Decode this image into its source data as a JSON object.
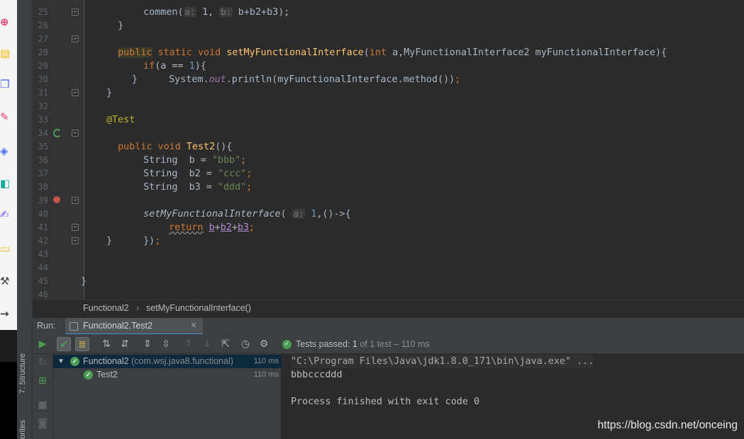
{
  "editor": {
    "line_numbers": [
      "25",
      "26",
      "27",
      "28",
      "29",
      "30",
      "31",
      "32",
      "33",
      "34",
      "35",
      "36",
      "37",
      "38",
      "39",
      "40",
      "41",
      "42",
      "43",
      "44",
      "45",
      "46"
    ],
    "code": {
      "l25_a": "commen(",
      "l25_h1": "a:",
      "l25_b": " 1, ",
      "l25_h2": "b:",
      "l25_c": " b+b2+b3);",
      "l25_close": "}",
      "l27_public": "public",
      "l27_static": " static void ",
      "l27_fn": "setMyFunctionalInterface",
      "l27_open": "(",
      "l27_int": "int",
      "l27_rest": " a,MyFunctionalInterface2 myFunctionalInterface){",
      "l28_if": "if",
      "l28_a": "(a == ",
      "l28_num": "1",
      "l28_b": "){",
      "l29_a": "System.",
      "l29_out": "out",
      "l29_b": ".println(myFunctionalInterface.method())",
      "l29_semi": ";",
      "l30": "}",
      "l31": "}",
      "l33": "@Test",
      "l34_kw": "public void ",
      "l34_fn": "Test2",
      "l34_rest": "(){",
      "l35_a": "String  b = ",
      "l35_str": "\"bbb\"",
      "l35_semi": ";",
      "l36_a": "String  b2 = ",
      "l36_str": "\"ccc\"",
      "l36_semi": ";",
      "l37_a": "String  b3 = ",
      "l37_str": "\"ddd\"",
      "l37_semi": ";",
      "l39_fn": "setMyFunctionalInterface",
      "l39_open": "( ",
      "l39_hint": "a:",
      "l39_num": " 1",
      "l39_rest": ",()->{",
      "l40_ret": "return",
      "l40_sp": " ",
      "l40_b": "b",
      "l40_p1": "+",
      "l40_b2": "b2",
      "l40_p2": "+",
      "l40_b3": "b3",
      "l40_semi": ";",
      "l41_a": "})",
      "l41_semi": ";",
      "l42": "}",
      "l45": "}"
    }
  },
  "breadcrumb": {
    "class_name": "Functional2",
    "separator": "›",
    "method_name": "setMyFunctionalInterface()"
  },
  "run_panel": {
    "run_label": "Run:",
    "tab_label": "Functional2.Test2",
    "tab_close": "×",
    "toolbar_icons": [
      "rerun-icon",
      "show-passed-icon",
      "show-ignored-icon",
      "sort-alpha-icon",
      "sort-duration-icon",
      "expand-all-icon",
      "collapse-all-icon",
      "prev-failed-icon",
      "next-failed-icon",
      "export-icon",
      "history-icon",
      "settings-icon"
    ],
    "status": {
      "prefix": "Tests passed: ",
      "count": "1",
      "middle": " of 1 test – ",
      "duration": "110 ms"
    },
    "tree": [
      {
        "name": "Functional2",
        "package": " (com.wsj.java8.functional)",
        "time": "110 ms"
      },
      {
        "name": "Test2",
        "time": "110 ms"
      }
    ],
    "console": [
      "\"C:\\Program Files\\Java\\jdk1.8.0_171\\bin\\java.exe\" ...",
      "bbbcccddd",
      "",
      "Process finished with exit code 0"
    ]
  },
  "sidebar": {
    "structure_tab": "7: Structure",
    "favorites_tab": "orites"
  },
  "watermark": "https://blog.csdn.net/onceing",
  "colors": {
    "keyword": "#cc7832",
    "function": "#ffc66d",
    "string": "#6a8759",
    "number": "#6897bb",
    "annotation": "#bbb529",
    "pass": "#499c54",
    "background": "#2b2b2b"
  }
}
